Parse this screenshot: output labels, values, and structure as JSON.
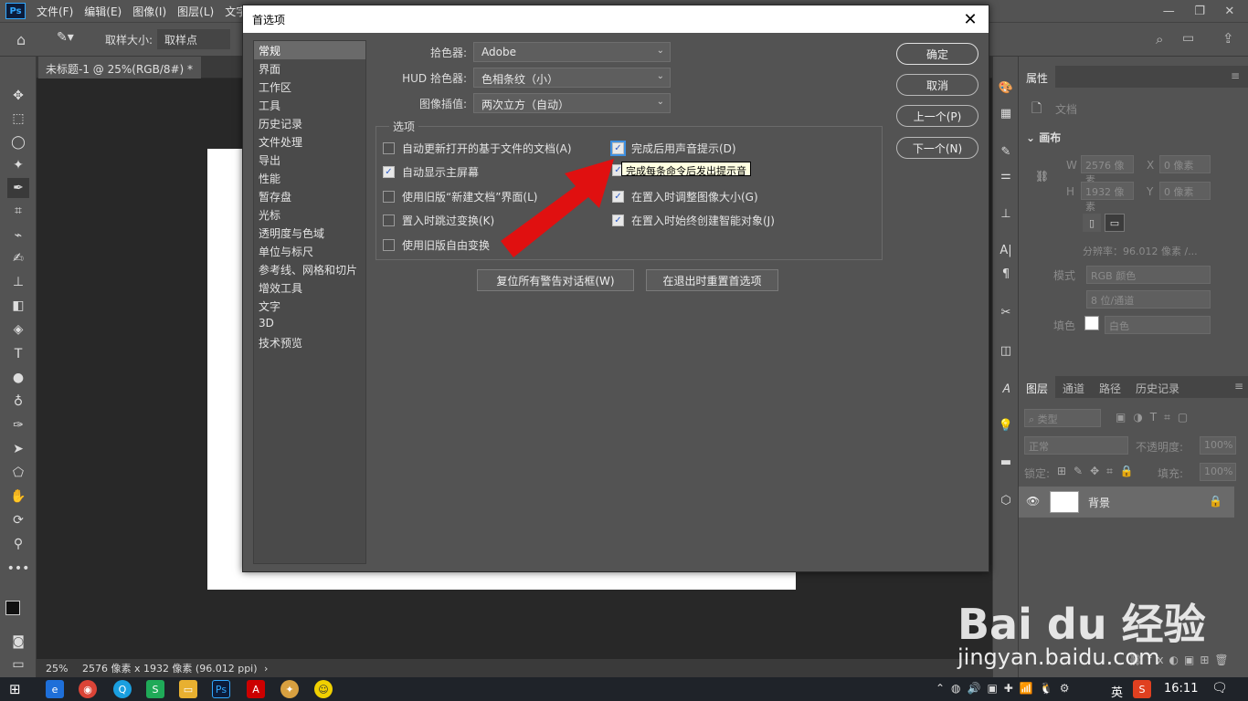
{
  "menubar": {
    "app_icon": "Ps",
    "items": [
      "文件(F)",
      "编辑(E)",
      "图像(I)",
      "图层(L)",
      "文字(Y)"
    ]
  },
  "options_bar": {
    "sample_size_label": "取样大小:",
    "sample_size_value": "取样点"
  },
  "document_tab": {
    "title": "未标题-1 @ 25%(RGB/8#) *",
    "close": "×"
  },
  "status_bar": {
    "zoom": "25%",
    "info": "2576 像素 x 1932 像素 (96.012 ppi)"
  },
  "dialog": {
    "title": "首选项",
    "close": "✕",
    "nav": [
      "常规",
      "界面",
      "工作区",
      "工具",
      "历史记录",
      "文件处理",
      "导出",
      "性能",
      "暂存盘",
      "光标",
      "透明度与色域",
      "单位与标尺",
      "参考线、网格和切片",
      "增效工具",
      "文字",
      "3D",
      "技术预览"
    ],
    "nav_selected": 0,
    "color_picker_label": "拾色器:",
    "color_picker_value": "Adobe",
    "hud_picker_label": "HUD 拾色器:",
    "hud_picker_value": "色相条纹（小）",
    "interp_label": "图像插值:",
    "interp_value": "两次立方（自动）",
    "options_group_title": "选项",
    "options": [
      {
        "label": "自动更新打开的基于文件的文档(A)",
        "checked": false
      },
      {
        "label": "自动显示主屏幕",
        "checked": true
      },
      {
        "label": "使用旧版“新建文档”界面(L)",
        "checked": false
      },
      {
        "label": "置入时跳过变换(K)",
        "checked": false
      },
      {
        "label": "使用旧版自由变换",
        "checked": false
      },
      {
        "label": "完成后用声音提示(D)",
        "checked": true
      },
      {
        "label": "",
        "checked": true
      },
      {
        "label": "在置入时调整图像大小(G)",
        "checked": true
      },
      {
        "label": "在置入时始终创建智能对象(J)",
        "checked": true
      }
    ],
    "tooltip": "完成每条命令后发出提示音",
    "reset_warnings_button": "复位所有警告对话框(W)",
    "reset_on_quit_button": "在退出时重置首选项",
    "ok_button": "确定",
    "cancel_button": "取消",
    "prev_button": "上一个(P)",
    "next_button": "下一个(N)"
  },
  "properties_panel": {
    "tab": "属性",
    "doc_label": "文档",
    "canvas_section": "画布",
    "w_label": "W",
    "w_value": "2576 像素",
    "h_label": "H",
    "h_value": "1932 像素",
    "x_label": "X",
    "x_value": "0 像素",
    "y_label": "Y",
    "y_value": "0 像素",
    "resolution": "分辨率：96.012 像素 /...",
    "mode_label": "模式",
    "mode_value": "RGB 颜色",
    "depth_value": "8 位/通道",
    "fill_label": "填色",
    "fill_value": "白色"
  },
  "layers_panel": {
    "tabs": [
      "图层",
      "通道",
      "路径",
      "历史记录"
    ],
    "filter_placeholder": "类型",
    "blend_mode": "正常",
    "opacity_label": "不透明度:",
    "opacity_value": "100%",
    "lock_label": "锁定:",
    "fill_label": "填充:",
    "fill_value": "100%",
    "layer_name": "背景"
  },
  "taskbar": {
    "ime": "英",
    "clock": "16:11"
  },
  "watermark": {
    "logo": "Bai du 经验",
    "url": "jingyan.baidu.com"
  },
  "colors": {
    "annotation_arrow": "#e01010",
    "accent_blue": "#31a8ff"
  }
}
